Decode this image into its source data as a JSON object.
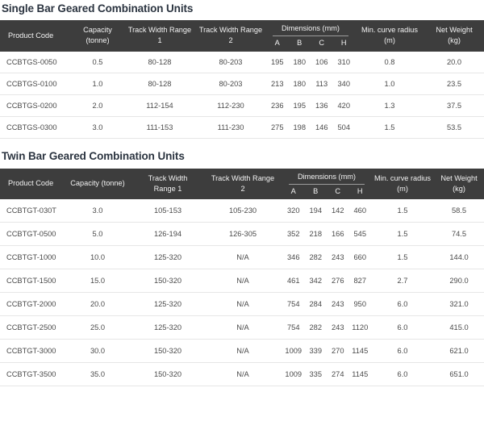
{
  "tables": [
    {
      "title": "Single Bar Geared Combination Units",
      "headers": {
        "product_code": "Product Code",
        "capacity_line1": "Capacity",
        "capacity_line2": "(tonne)",
        "twr1_line1": "Track Width Range",
        "twr1_line2": "1",
        "twr2_line1": "Track Width Range",
        "twr2_line2": "2",
        "dimensions": "Dimensions (mm)",
        "dim_a": "A",
        "dim_b": "B",
        "dim_c": "C",
        "dim_h": "H",
        "curve_line1": "Min. curve radius",
        "curve_line2": "(m)",
        "weight_line1": "Net Weight",
        "weight_line2": "(kg)"
      },
      "rows": [
        {
          "product_code": "CCBTGS-0050",
          "capacity": "0.5",
          "twr1": "80-128",
          "twr2": "80-203",
          "a": "195",
          "b": "180",
          "c": "106",
          "h": "310",
          "curve": "0.8",
          "weight": "20.0"
        },
        {
          "product_code": "CCBTGS-0100",
          "capacity": "1.0",
          "twr1": "80-128",
          "twr2": "80-203",
          "a": "213",
          "b": "180",
          "c": "113",
          "h": "340",
          "curve": "1.0",
          "weight": "23.5"
        },
        {
          "product_code": "CCBTGS-0200",
          "capacity": "2.0",
          "twr1": "112-154",
          "twr2": "112-230",
          "a": "236",
          "b": "195",
          "c": "136",
          "h": "420",
          "curve": "1.3",
          "weight": "37.5"
        },
        {
          "product_code": "CCBTGS-0300",
          "capacity": "3.0",
          "twr1": "111-153",
          "twr2": "111-230",
          "a": "275",
          "b": "198",
          "c": "146",
          "h": "504",
          "curve": "1.5",
          "weight": "53.5"
        }
      ]
    },
    {
      "title": "Twin Bar Geared Combination Units",
      "headers": {
        "product_code": "Product Code",
        "capacity_line1": "Capacity (tonne)",
        "capacity_line2": "",
        "twr1_line1": "Track Width",
        "twr1_line2": "Range 1",
        "twr2_line1": "Track Width Range",
        "twr2_line2": "2",
        "dimensions": "Dimensions (mm)",
        "dim_a": "A",
        "dim_b": "B",
        "dim_c": "C",
        "dim_h": "H",
        "curve_line1": "Min. curve radius",
        "curve_line2": "(m)",
        "weight_line1": "Net Weight",
        "weight_line2": "(kg)"
      },
      "rows": [
        {
          "product_code": "CCBTGT-030T",
          "capacity": "3.0",
          "twr1": "105-153",
          "twr2": "105-230",
          "a": "320",
          "b": "194",
          "c": "142",
          "h": "460",
          "curve": "1.5",
          "weight": "58.5"
        },
        {
          "product_code": "CCBTGT-0500",
          "capacity": "5.0",
          "twr1": "126-194",
          "twr2": "126-305",
          "a": "352",
          "b": "218",
          "c": "166",
          "h": "545",
          "curve": "1.5",
          "weight": "74.5"
        },
        {
          "product_code": "CCBTGT-1000",
          "capacity": "10.0",
          "twr1": "125-320",
          "twr2": "N/A",
          "a": "346",
          "b": "282",
          "c": "243",
          "h": "660",
          "curve": "1.5",
          "weight": "144.0"
        },
        {
          "product_code": "CCBTGT-1500",
          "capacity": "15.0",
          "twr1": "150-320",
          "twr2": "N/A",
          "a": "461",
          "b": "342",
          "c": "276",
          "h": "827",
          "curve": "2.7",
          "weight": "290.0"
        },
        {
          "product_code": "CCBTGT-2000",
          "capacity": "20.0",
          "twr1": "125-320",
          "twr2": "N/A",
          "a": "754",
          "b": "284",
          "c": "243",
          "h": "950",
          "curve": "6.0",
          "weight": "321.0"
        },
        {
          "product_code": "CCBTGT-2500",
          "capacity": "25.0",
          "twr1": "125-320",
          "twr2": "N/A",
          "a": "754",
          "b": "282",
          "c": "243",
          "h": "1120",
          "curve": "6.0",
          "weight": "415.0"
        },
        {
          "product_code": "CCBTGT-3000",
          "capacity": "30.0",
          "twr1": "150-320",
          "twr2": "N/A",
          "a": "1009",
          "b": "339",
          "c": "270",
          "h": "1145",
          "curve": "6.0",
          "weight": "621.0"
        },
        {
          "product_code": "CCBTGT-3500",
          "capacity": "35.0",
          "twr1": "150-320",
          "twr2": "N/A",
          "a": "1009",
          "b": "335",
          "c": "274",
          "h": "1145",
          "curve": "6.0",
          "weight": "651.0"
        }
      ]
    }
  ],
  "colors": {
    "header_bg": "#3d3d3d",
    "header_text": "#f2f2f2",
    "title_text": "#2b3440",
    "body_text": "#4a4a4a",
    "row_border": "#e6e6e6"
  }
}
